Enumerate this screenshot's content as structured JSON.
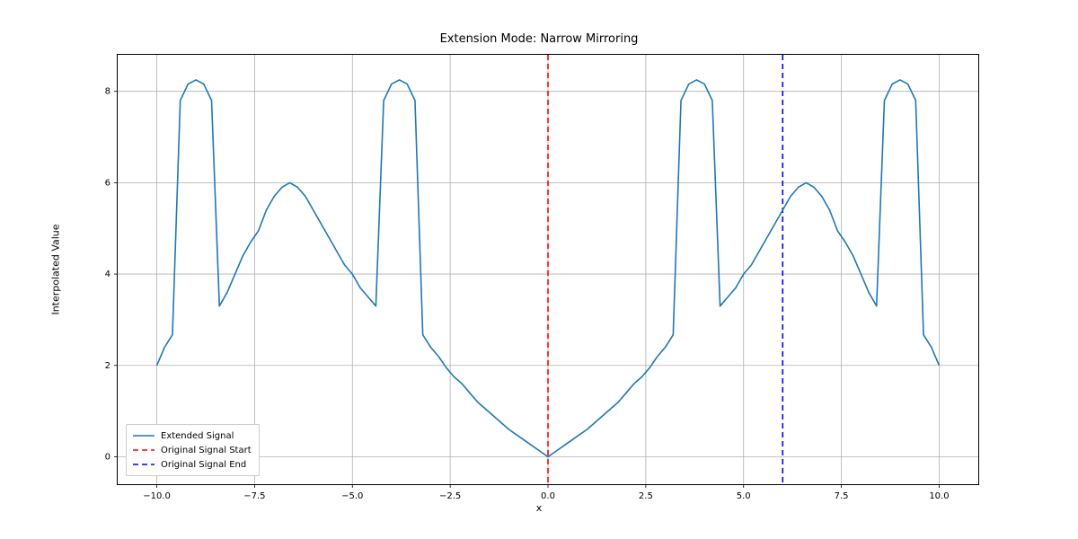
{
  "chart_data": {
    "type": "line",
    "title": "Extension Mode: Narrow Mirroring",
    "xlabel": "x",
    "ylabel": "Interpolated Value",
    "xlim": [
      -11.0,
      11.0
    ],
    "ylim": [
      -0.6,
      8.8
    ],
    "x_ticks": [
      -10.0,
      -7.5,
      -5.0,
      -2.5,
      0.0,
      2.5,
      5.0,
      7.5,
      10.0
    ],
    "y_ticks": [
      0,
      2,
      4,
      6,
      8
    ],
    "series": [
      {
        "name": "Extended Signal",
        "color": "#1f77b4",
        "dash": "solid",
        "x": [
          -10.0,
          -9.8,
          -9.6,
          -9.4,
          -9.2,
          -9.0,
          -8.8,
          -8.6,
          -8.4,
          -8.2,
          -8.0,
          -7.8,
          -7.6,
          -7.4,
          -7.2,
          -7.0,
          -6.8,
          -6.6,
          -6.4,
          -6.2,
          -6.0,
          -5.8,
          -5.6,
          -5.4,
          -5.2,
          -5.0,
          -4.8,
          -4.6,
          -4.4,
          -4.2,
          -4.0,
          -3.8,
          -3.6,
          -3.4,
          -3.2,
          -3.0,
          -2.8,
          -2.6,
          -2.4,
          -2.2,
          -2.0,
          -1.8,
          -1.6,
          -1.4,
          -1.2,
          -1.0,
          -0.8,
          -0.6,
          -0.4,
          -0.2,
          0.0,
          0.2,
          0.4,
          0.6,
          0.8,
          1.0,
          1.2,
          1.4,
          1.6,
          1.8,
          2.0,
          2.2,
          2.4,
          2.6,
          2.8,
          3.0,
          3.2,
          3.4,
          3.6,
          3.8,
          4.0,
          4.2,
          4.4,
          4.6,
          4.8,
          5.0,
          5.2,
          5.4,
          5.6,
          5.8,
          6.0,
          6.2,
          6.4,
          6.6,
          6.8,
          7.0,
          7.2,
          7.4,
          7.6,
          7.8,
          8.0,
          8.2,
          8.4,
          8.6,
          8.8,
          9.0,
          9.2,
          9.4,
          9.6,
          9.8,
          10.0
        ],
        "y": [
          2.0,
          2.4,
          2.67,
          7.8,
          8.16,
          8.25,
          8.16,
          7.8,
          3.3,
          3.6,
          4.0,
          4.4,
          4.7,
          4.95,
          5.4,
          5.7,
          5.9,
          6.0,
          5.9,
          5.7,
          5.4,
          5.1,
          4.8,
          4.5,
          4.2,
          4.0,
          3.7,
          3.5,
          3.3,
          7.8,
          8.16,
          8.25,
          8.16,
          7.8,
          2.67,
          2.4,
          2.2,
          1.95,
          1.75,
          1.6,
          1.4,
          1.2,
          1.05,
          0.9,
          0.75,
          0.6,
          0.48,
          0.36,
          0.24,
          0.12,
          0.0,
          0.12,
          0.24,
          0.36,
          0.48,
          0.6,
          0.75,
          0.9,
          1.05,
          1.2,
          1.4,
          1.6,
          1.75,
          1.95,
          2.2,
          2.4,
          2.67,
          7.8,
          8.16,
          8.25,
          8.16,
          7.8,
          3.3,
          3.5,
          3.7,
          4.0,
          4.2,
          4.5,
          4.8,
          5.1,
          5.4,
          5.7,
          5.9,
          6.0,
          5.9,
          5.7,
          5.4,
          4.95,
          4.7,
          4.4,
          4.0,
          3.6,
          3.3,
          7.8,
          8.16,
          8.25,
          8.16,
          7.8,
          2.67,
          2.4,
          2.0
        ]
      }
    ],
    "vlines": [
      {
        "name": "Original Signal Start",
        "x": 0,
        "color": "#ff0000",
        "dash": "dashed"
      },
      {
        "name": "Original Signal End",
        "x": 6,
        "color": "#0000ff",
        "dash": "dashed"
      }
    ],
    "legend": [
      "Extended Signal",
      "Original Signal Start",
      "Original Signal End"
    ],
    "legend_loc": "lower left"
  },
  "labels": {
    "title": "Extension Mode: Narrow Mirroring",
    "xlabel": "x",
    "ylabel": "Interpolated Value",
    "legend_extended": "Extended Signal",
    "legend_start": "Original Signal Start",
    "legend_end": "Original Signal End"
  }
}
